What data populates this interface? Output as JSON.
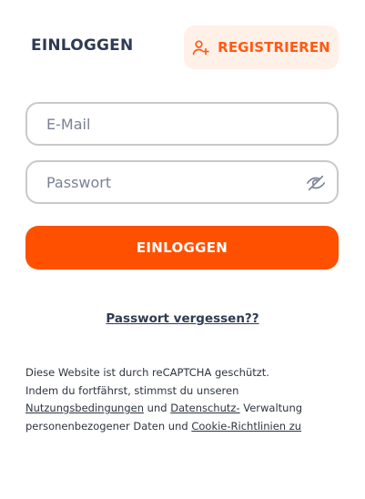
{
  "tabs": {
    "login_label": "EINLOGGEN",
    "register_label": "REGISTRIEREN",
    "register_icon": "user-plus-icon"
  },
  "form": {
    "email_placeholder": "E-Mail",
    "password_placeholder": "Passwort",
    "password_toggle_icon": "eye-off-icon",
    "submit_label": "EINLOGGEN"
  },
  "forgot": {
    "label": "Passwort vergessen??"
  },
  "legal": {
    "line1": "Diese Website ist durch reCAPTCHA geschützt.",
    "line2_prefix": "Indem du fortfährst, stimmst du unseren",
    "terms_link": "Nutzungsbedingungen",
    "and1": "und",
    "privacy_link": "Datenschutz-",
    "privacy_rest": "Verwaltung personenbezogener Daten",
    "and2": "und",
    "cookie_link": "Cookie-Richtlinien zu"
  },
  "colors": {
    "accent": "#ff5000",
    "accent_soft": "#fff0e8",
    "text_dark": "#2f3b52",
    "border": "#c8c9cc"
  }
}
